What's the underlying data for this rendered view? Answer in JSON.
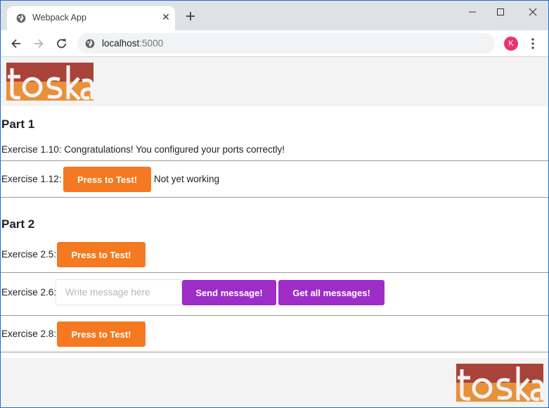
{
  "browser": {
    "tab_title": "Webpack App",
    "address_host": "localhost",
    "address_port": ":5000",
    "profile_initial": "K"
  },
  "brand": {
    "logo_text": "toska",
    "logo_colors": {
      "top": "#a8433a",
      "bottom": "#e8913a"
    }
  },
  "part1": {
    "heading": "Part 1",
    "ex110_text": "Exercise 1.10: Congratulations! You configured your ports correctly!",
    "ex112_label": "Exercise 1.12:",
    "ex112_button": "Press to Test!",
    "ex112_status": "Not yet working"
  },
  "part2": {
    "heading": "Part 2",
    "ex25_label": "Exercise 2.5:",
    "ex25_button": "Press to Test!",
    "ex26_label": "Exercise 2.6:",
    "ex26_placeholder": "Write message here",
    "ex26_send_button": "Send message!",
    "ex26_get_button": "Get all messages!",
    "ex28_label": "Exercise 2.8:",
    "ex28_button": "Press to Test!"
  },
  "colors": {
    "orange_button": "#f47920",
    "purple_button": "#9d2dc6",
    "avatar": "#e8336b"
  }
}
